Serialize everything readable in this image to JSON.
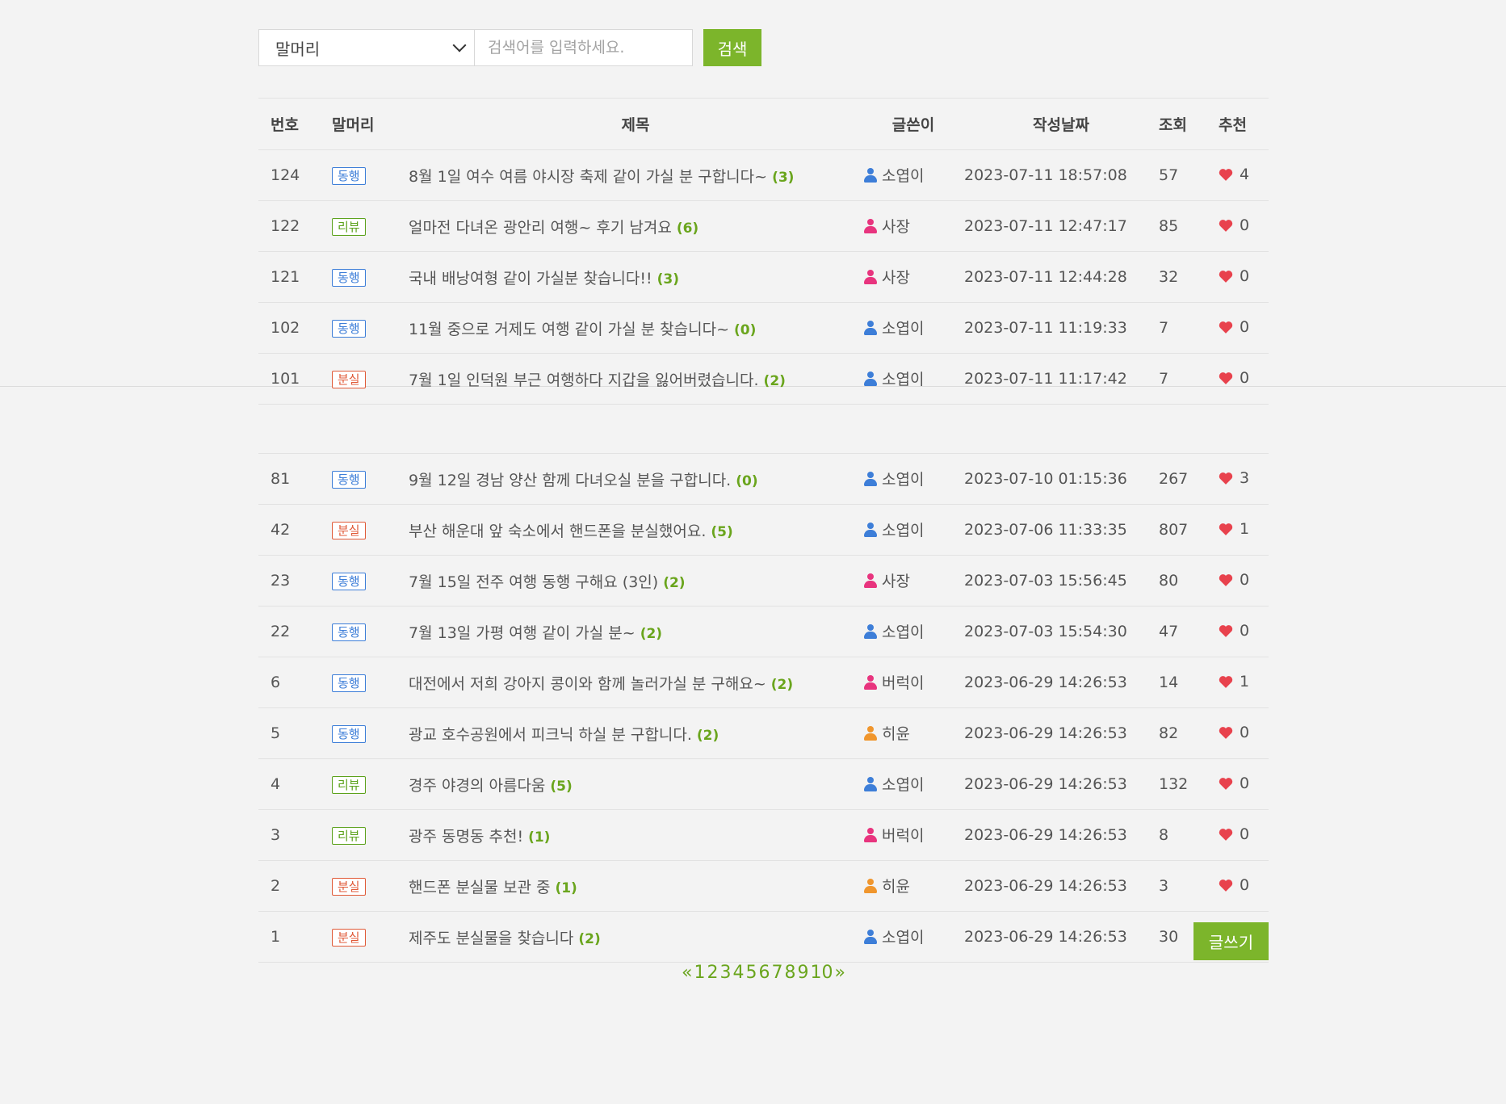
{
  "search": {
    "category_selected": "말머리",
    "placeholder": "검색어를 입력하세요.",
    "button_label": "검색"
  },
  "table": {
    "headers": [
      "번호",
      "말머리",
      "제목",
      "글쓴이",
      "작성날짜",
      "조회",
      "추천"
    ],
    "rows": [
      {
        "no": "124",
        "cat": "동행",
        "cat_type": "dh",
        "title": "8월 1일 여수 여름 야시장 축제 같이 가실 분 구합니다~",
        "comments": "(3)",
        "writer": "소엽이",
        "writer_color": "#3d7ed8",
        "date": "2023-07-11 18:57:08",
        "views": "57",
        "rec": "4"
      },
      {
        "no": "122",
        "cat": "리뷰",
        "cat_type": "rv",
        "title": "얼마전 다녀온 광안리 여행~ 후기 남겨요",
        "comments": "(6)",
        "writer": "사장",
        "writer_color": "#e8347e",
        "date": "2023-07-11 12:47:17",
        "views": "85",
        "rec": "0"
      },
      {
        "no": "121",
        "cat": "동행",
        "cat_type": "dh",
        "title": "국내 배낭여형 같이 가실분 찾습니다!!",
        "comments": "(3)",
        "writer": "사장",
        "writer_color": "#e8347e",
        "date": "2023-07-11 12:44:28",
        "views": "32",
        "rec": "0"
      },
      {
        "no": "102",
        "cat": "동행",
        "cat_type": "dh",
        "title": "11월 중으로 거제도 여행 같이 가실 분 찾습니다~",
        "comments": "(0)",
        "writer": "소엽이",
        "writer_color": "#3d7ed8",
        "date": "2023-07-11 11:19:33",
        "views": "7",
        "rec": "0"
      },
      {
        "no": "101",
        "cat": "분실",
        "cat_type": "bs",
        "title": "7월 1일 인덕원 부근 여행하다 지갑을 잃어버렸습니다.",
        "comments": "(2)",
        "writer": "소엽이",
        "writer_color": "#3d7ed8",
        "date": "2023-07-11 11:17:42",
        "views": "7",
        "rec": "0"
      },
      {
        "no": "81",
        "cat": "동행",
        "cat_type": "dh",
        "title": "9월 12일 경남 양산 함께 다녀오실 분을 구합니다.",
        "comments": "(0)",
        "writer": "소엽이",
        "writer_color": "#3d7ed8",
        "date": "2023-07-10 01:15:36",
        "views": "267",
        "rec": "3"
      },
      {
        "no": "42",
        "cat": "분실",
        "cat_type": "bs",
        "title": "부산 해운대 앞 숙소에서 핸드폰을 분실했어요.",
        "comments": "(5)",
        "writer": "소엽이",
        "writer_color": "#3d7ed8",
        "date": "2023-07-06 11:33:35",
        "views": "807",
        "rec": "1"
      },
      {
        "no": "23",
        "cat": "동행",
        "cat_type": "dh",
        "title": "7월 15일 전주 여행 동행 구해요 (3인)",
        "comments": "(2)",
        "writer": "사장",
        "writer_color": "#e8347e",
        "date": "2023-07-03 15:56:45",
        "views": "80",
        "rec": "0"
      },
      {
        "no": "22",
        "cat": "동행",
        "cat_type": "dh",
        "title": "7월 13일 가평 여행 같이 가실 분~",
        "comments": "(2)",
        "writer": "소엽이",
        "writer_color": "#3d7ed8",
        "date": "2023-07-03 15:54:30",
        "views": "47",
        "rec": "0"
      },
      {
        "no": "6",
        "cat": "동행",
        "cat_type": "dh",
        "title": "대전에서 저희 강아지 콩이와 함께 놀러가실 분 구해요~",
        "comments": "(2)",
        "writer": "버럭이",
        "writer_color": "#e8347e",
        "date": "2023-06-29 14:26:53",
        "views": "14",
        "rec": "1"
      },
      {
        "no": "5",
        "cat": "동행",
        "cat_type": "dh",
        "title": "광교 호수공원에서 피크닉 하실 분 구합니다.",
        "comments": "(2)",
        "writer": "히윤",
        "writer_color": "#f0962d",
        "date": "2023-06-29 14:26:53",
        "views": "82",
        "rec": "0"
      },
      {
        "no": "4",
        "cat": "리뷰",
        "cat_type": "rv",
        "title": "경주 야경의 아름다움",
        "comments": "(5)",
        "writer": "소엽이",
        "writer_color": "#3d7ed8",
        "date": "2023-06-29 14:26:53",
        "views": "132",
        "rec": "0"
      },
      {
        "no": "3",
        "cat": "리뷰",
        "cat_type": "rv",
        "title": "광주 동명동 추천!",
        "comments": "(1)",
        "writer": "버럭이",
        "writer_color": "#e8347e",
        "date": "2023-06-29 14:26:53",
        "views": "8",
        "rec": "0"
      },
      {
        "no": "2",
        "cat": "분실",
        "cat_type": "bs",
        "title": "핸드폰 분실물 보관 중",
        "comments": "(1)",
        "writer": "히윤",
        "writer_color": "#f0962d",
        "date": "2023-06-29 14:26:53",
        "views": "3",
        "rec": "0"
      },
      {
        "no": "1",
        "cat": "분실",
        "cat_type": "bs",
        "title": "제주도 분실물을 찾습니다",
        "comments": "(2)",
        "writer": "소엽이",
        "writer_color": "#3d7ed8",
        "date": "2023-06-29 14:26:53",
        "views": "30",
        "rec": "0"
      }
    ]
  },
  "heart_color": "#e8424d",
  "write_button_label": "글쓰기",
  "pagination": {
    "prev": "«",
    "pages": [
      "1",
      "2",
      "3",
      "4",
      "5",
      "6",
      "7",
      "8",
      "9",
      "10"
    ],
    "next": "»"
  }
}
